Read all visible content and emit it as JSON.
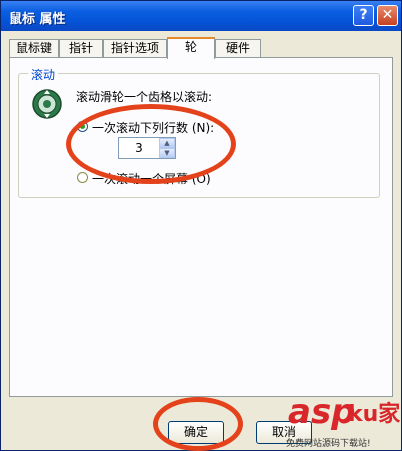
{
  "window": {
    "title": "鼠标 属性",
    "help_label": "?",
    "close_label": "✕"
  },
  "tabs": [
    {
      "label": "鼠标键"
    },
    {
      "label": "指针"
    },
    {
      "label": "指针选项"
    },
    {
      "label": "轮"
    },
    {
      "label": "硬件"
    }
  ],
  "active_tab": "轮",
  "scroll_group": {
    "label": "滚动",
    "description": "滚动滑轮一个齿格以滚动:",
    "option_lines": "一次滚动下列行数 (N):",
    "option_lines_selected": true,
    "lines_value": "3",
    "option_screen": "一次滚动一个屏幕 (O)"
  },
  "buttons": {
    "ok": "确定",
    "cancel": "取消"
  },
  "watermark": {
    "brand": "asp",
    "suffix": "ku家",
    "tagline": "免费网站源码下载站!"
  },
  "colors": {
    "highlight": "#e4421b",
    "title_blue": "#0553d6",
    "group_label": "#0046d5"
  }
}
